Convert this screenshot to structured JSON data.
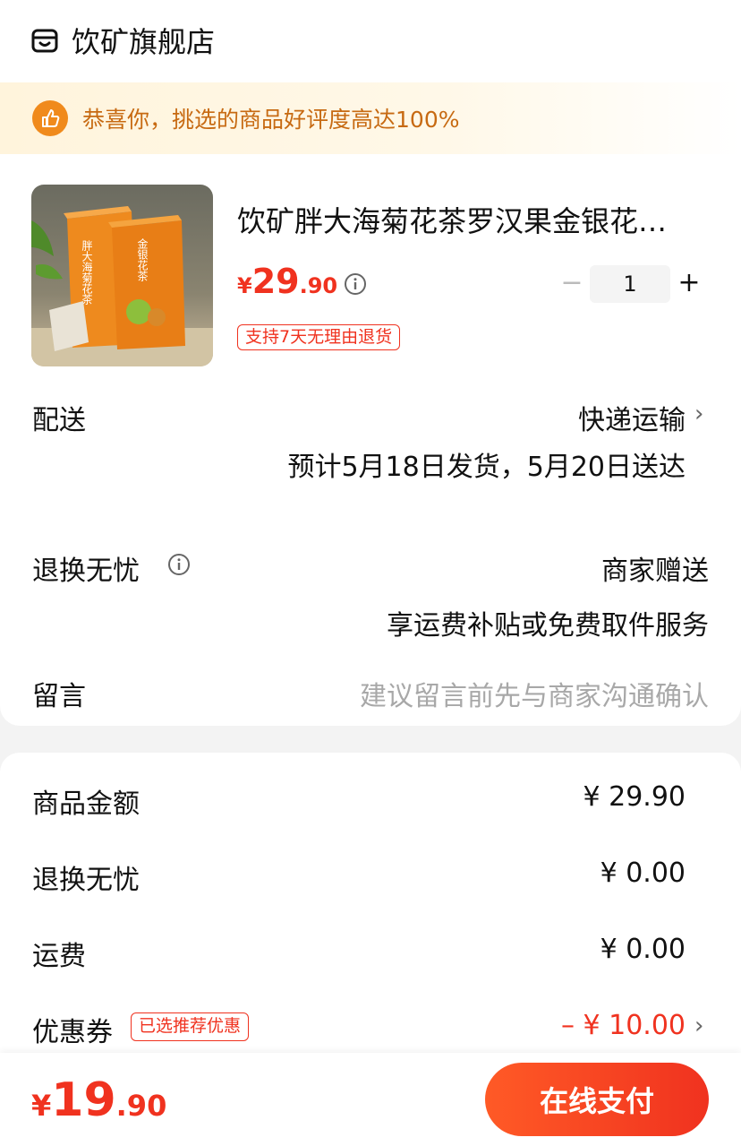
{
  "store": {
    "name": "饮矿旗舰店",
    "icon": "store-icon"
  },
  "banner": {
    "text": "恭喜你，挑选的商品好评度高达100%",
    "icon": "thumbs-up-icon"
  },
  "product": {
    "title": "饮矿胖大海菊花茶罗汉果金银花…",
    "price_yen": "¥",
    "price_int": "29",
    "price_dec": ".90",
    "quantity": "1",
    "minus": "−",
    "plus": "+",
    "return_badge": "支持7天无理由退货",
    "box_text_front": "胖大海菊花茶",
    "box_text_back": "金银花茶"
  },
  "delivery": {
    "label": "配送",
    "method": "快递运输",
    "estimate": "预计5月18日发货，5月20日送达"
  },
  "return_service": {
    "label": "退换无忧",
    "value": "商家赠送",
    "desc": "享运费补贴或免费取件服务"
  },
  "message": {
    "label": "留言",
    "placeholder": "建议留言前先与商家沟通确认"
  },
  "summary": {
    "goods_label": "商品金额",
    "goods_value": "¥ 29.90",
    "return_label": "退换无忧",
    "return_value": "¥ 0.00",
    "shipping_label": "运费",
    "shipping_value": "¥ 0.00",
    "coupon_label": "优惠券",
    "coupon_badge": "已选推荐优惠",
    "coupon_value": "– ¥ 10.00"
  },
  "footer": {
    "total_yen": "¥",
    "total_int": "19",
    "total_dec": ".90",
    "pay_label": "在线支付"
  },
  "colors": {
    "accent": "#f0321f",
    "banner_text": "#c76a12",
    "banner_icon": "#f08a1c"
  }
}
